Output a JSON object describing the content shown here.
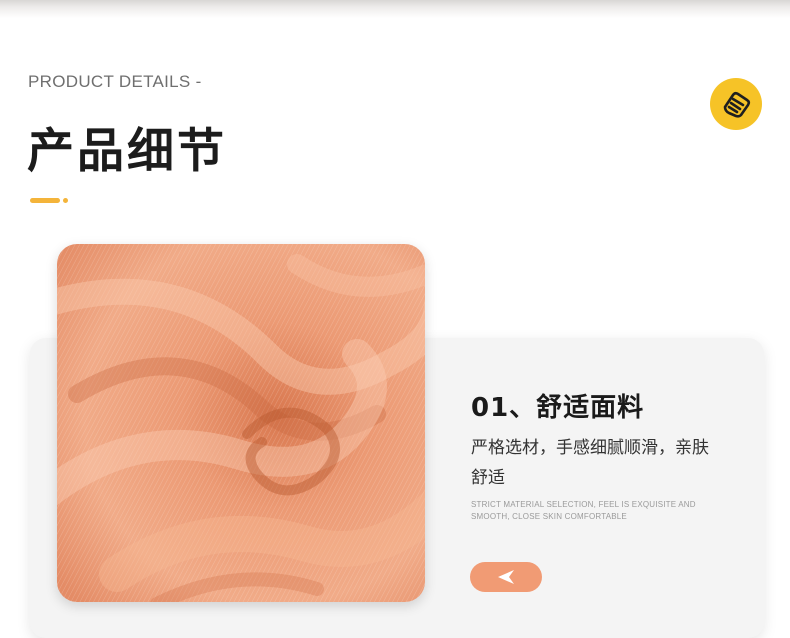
{
  "header": {
    "eyebrow": "PRODUCT DETAILS -",
    "title": "产品细节"
  },
  "badge": {
    "icon": "hand-icon",
    "color": "#f6c327"
  },
  "feature": {
    "title": "01、舒适面料",
    "desc": "严格选材，手感细腻顺滑，亲肤舒适",
    "desc_en": "Strict material selection, feel is exquisite and smooth, close skin comfortable",
    "button_icon": "arrow-left-icon",
    "button_color": "#f19b74"
  },
  "colors": {
    "accent": "#f4b43a",
    "fabric": "#e98e67",
    "card_bg": "#f4f4f4"
  }
}
